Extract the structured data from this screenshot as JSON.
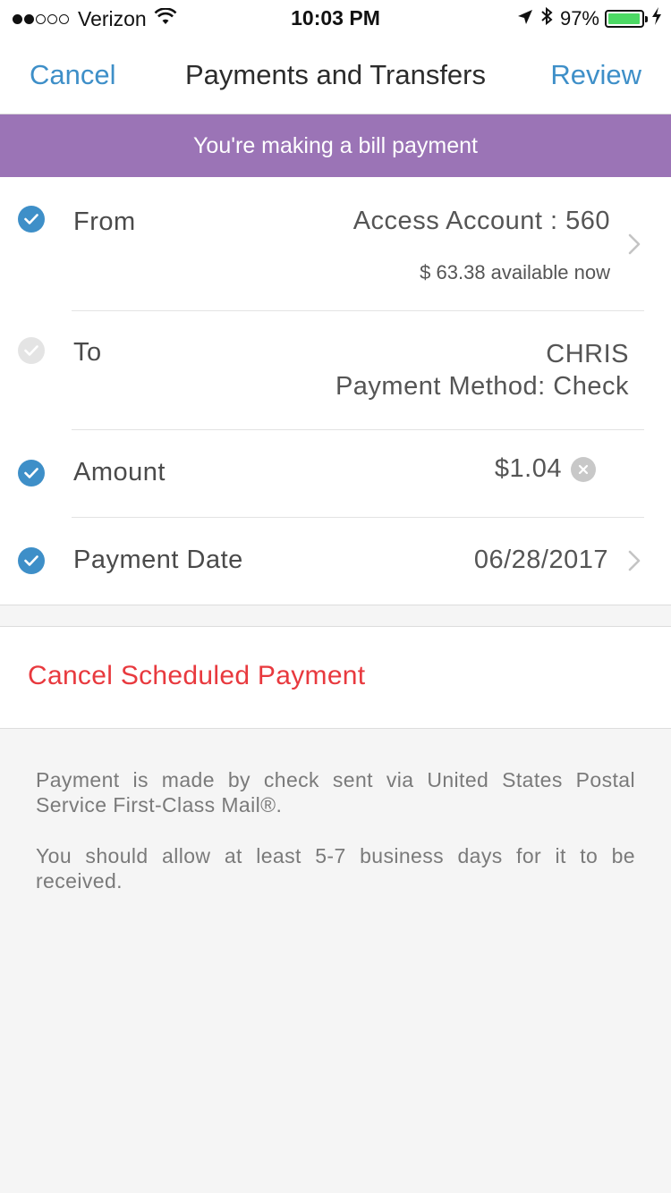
{
  "status_bar": {
    "carrier": "Verizon",
    "time": "10:03 PM",
    "battery": "97%",
    "battery_level": 0.97,
    "signal_bars": 2,
    "icons": [
      "wifi-icon",
      "location-icon",
      "bluetooth-icon",
      "charging-icon"
    ]
  },
  "nav": {
    "left_label": "Cancel",
    "title": "Payments and Transfers",
    "right_label": "Review"
  },
  "banner": {
    "text": "You're making a bill payment",
    "color": "#9b74b6"
  },
  "form": {
    "from": {
      "label": "From",
      "value": "Access Account : 560",
      "sub_value": "$ 63.38 available now"
    },
    "to": {
      "label": "To",
      "payee": "CHRIS",
      "method": "Payment Method: Check"
    },
    "amount": {
      "label": "Amount",
      "value": "$1.04"
    },
    "date": {
      "label": "Payment Date",
      "value": "06/28/2017"
    }
  },
  "actions": {
    "cancel_scheduled": "Cancel Scheduled Payment"
  },
  "info": {
    "line1": "Payment is made by check sent via United States Postal Service First-Class Mail®.",
    "line2": "You should allow at least 5-7 business days for it to be received."
  },
  "colors": {
    "accent": "#3e8fc8",
    "danger": "#e8393e",
    "banner": "#9b74b6"
  }
}
